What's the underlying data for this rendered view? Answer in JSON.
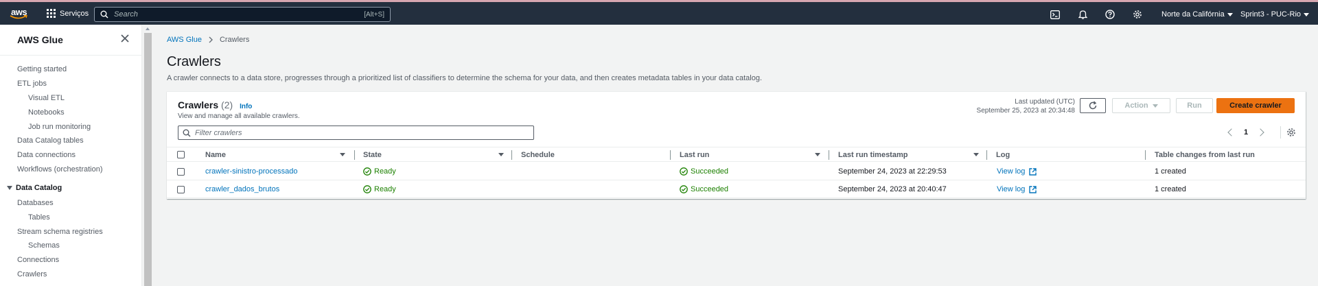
{
  "topnav": {
    "logo": "aws",
    "services_label": "Serviços",
    "search_placeholder": "Search",
    "search_shortcut": "[Alt+S]",
    "region": "Norte da Califórnia",
    "account": "Sprint3 - PUC-Rio",
    "icons": [
      "cloudshell-icon",
      "bell-icon",
      "help-icon",
      "settings-icon"
    ]
  },
  "sidebar": {
    "title": "AWS Glue",
    "items": [
      {
        "label": "Getting started",
        "level": 0
      },
      {
        "label": "ETL jobs",
        "level": 0
      },
      {
        "label": "Visual ETL",
        "level": 1
      },
      {
        "label": "Notebooks",
        "level": 1
      },
      {
        "label": "Job run monitoring",
        "level": 1
      },
      {
        "label": "Data Catalog tables",
        "level": 0
      },
      {
        "label": "Data connections",
        "level": 0
      },
      {
        "label": "Workflows (orchestration)",
        "level": 0
      }
    ],
    "section": "Data Catalog",
    "section_items": [
      {
        "label": "Databases",
        "level": 0
      },
      {
        "label": "Tables",
        "level": 1
      },
      {
        "label": "Stream schema registries",
        "level": 0
      },
      {
        "label": "Schemas",
        "level": 1
      },
      {
        "label": "Connections",
        "level": 0
      },
      {
        "label": "Crawlers",
        "level": 0
      }
    ]
  },
  "breadcrumb": {
    "root": "AWS Glue",
    "current": "Crawlers"
  },
  "page": {
    "title": "Crawlers",
    "description": "A crawler connects to a data store, progresses through a prioritized list of classifiers to determine the schema for your data, and then creates metadata tables in your data catalog."
  },
  "panel": {
    "title": "Crawlers",
    "count": "(2)",
    "info": "Info",
    "subtitle": "View and manage all available crawlers.",
    "updated_label": "Last updated (UTC)",
    "updated_value": "September 25, 2023 at 20:34:48",
    "action_label": "Action",
    "run_label": "Run",
    "create_label": "Create crawler",
    "filter_placeholder": "Filter crawlers",
    "page_number": "1"
  },
  "table": {
    "headers": {
      "name": "Name",
      "state": "State",
      "schedule": "Schedule",
      "last_run": "Last run",
      "last_run_timestamp": "Last run timestamp",
      "log": "Log",
      "table_changes": "Table changes from last run"
    },
    "rows": [
      {
        "name": "crawler-sinistro-processado",
        "state": "Ready",
        "schedule": "",
        "last_run": "Succeeded",
        "timestamp": "September 24, 2023 at 22:29:53",
        "log": "View log",
        "changes": "1 created"
      },
      {
        "name": "crawler_dados_brutos",
        "state": "Ready",
        "schedule": "",
        "last_run": "Succeeded",
        "timestamp": "September 24, 2023 at 20:40:47",
        "log": "View log",
        "changes": "1 created"
      }
    ]
  },
  "colors": {
    "nav_bg": "#232f3e",
    "primary": "#ec7211",
    "link": "#0073bb",
    "success": "#1d8102"
  }
}
